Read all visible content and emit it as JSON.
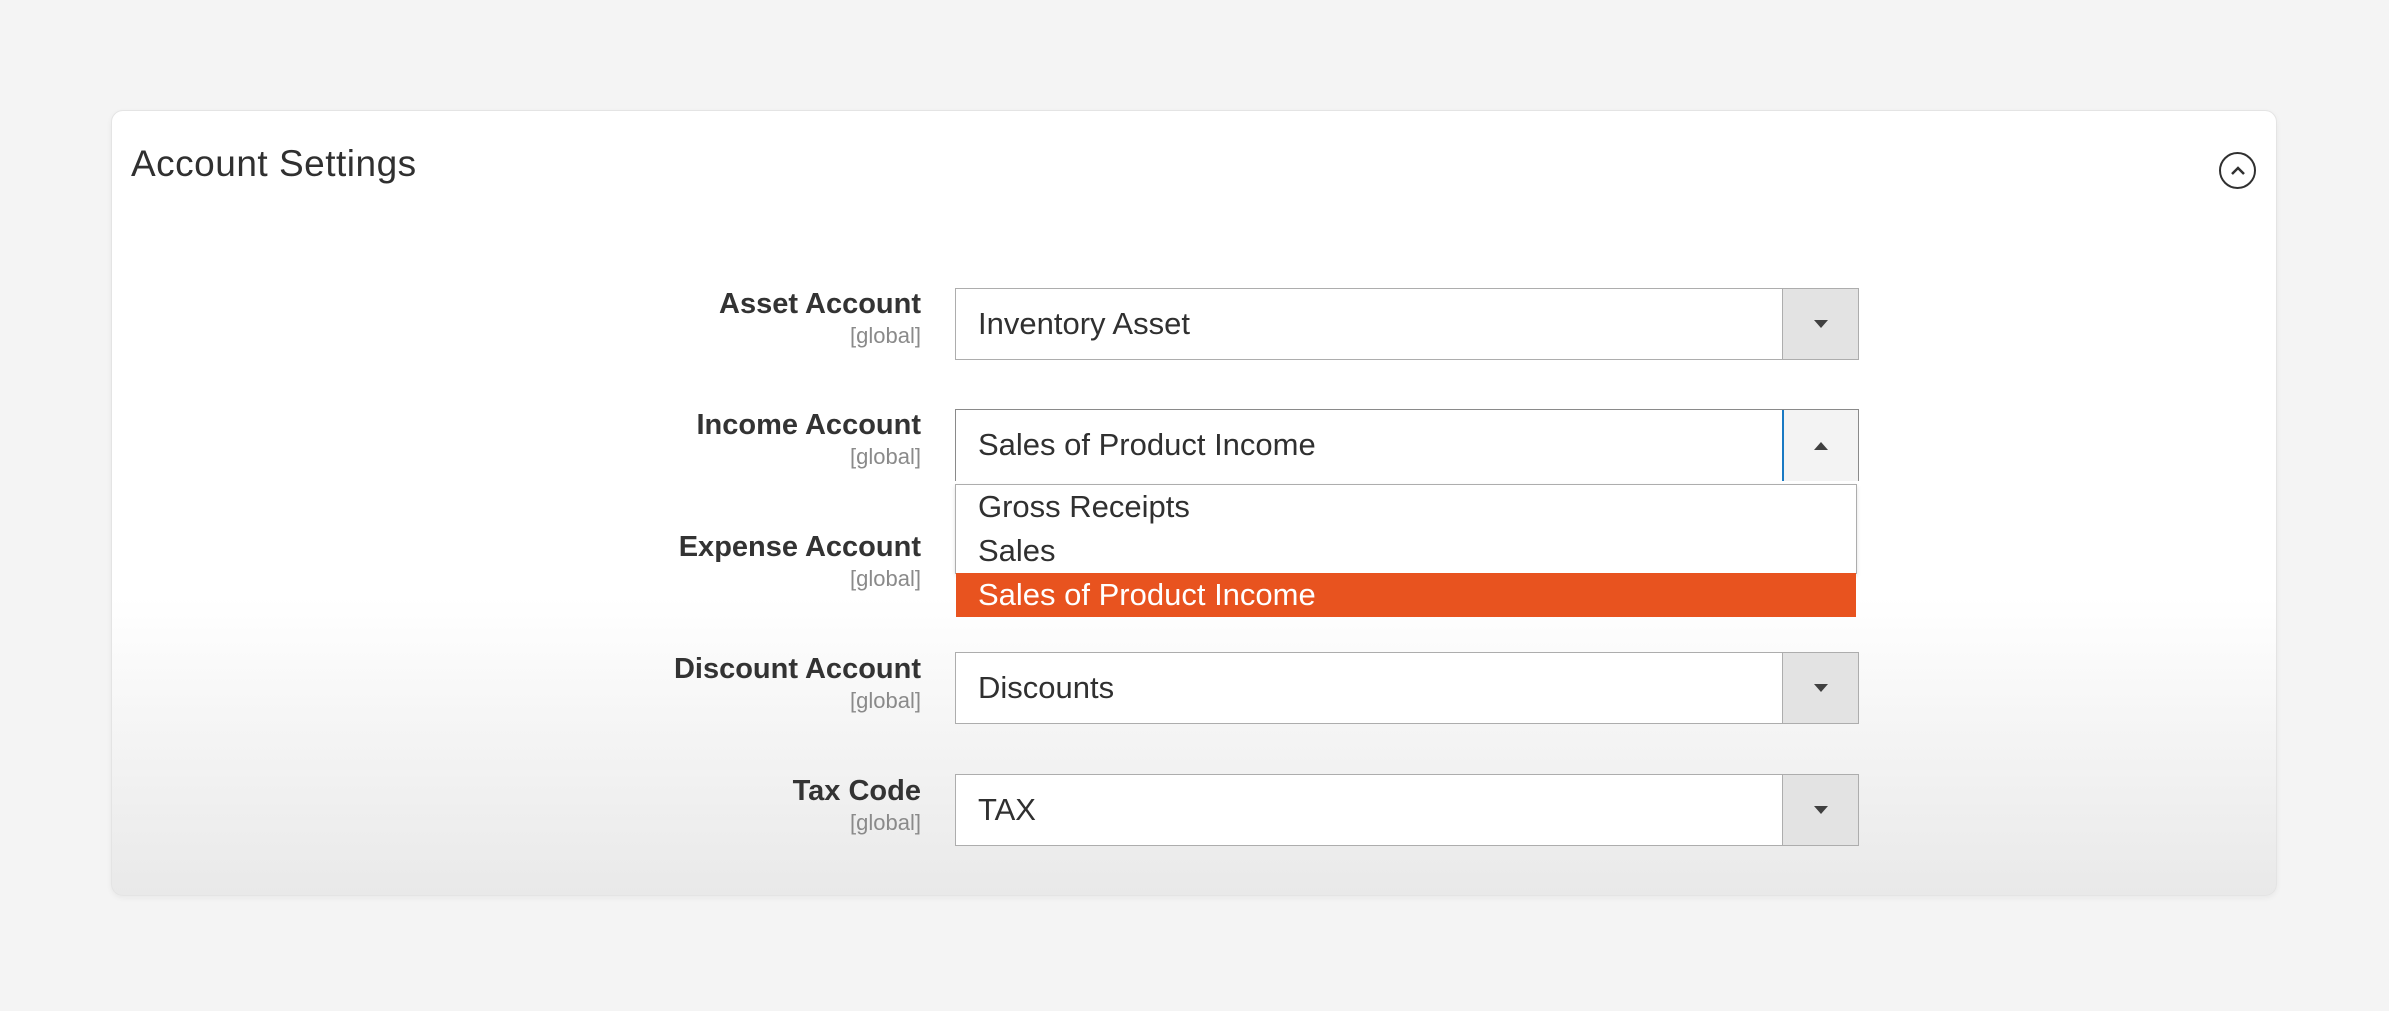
{
  "section": {
    "title": "Account Settings",
    "collapse_icon": "chevron-up-circle-icon"
  },
  "fields": [
    {
      "label": "Asset Account",
      "scope": "[global]",
      "value": "Inventory Asset",
      "open": false
    },
    {
      "label": "Income Account",
      "scope": "[global]",
      "value": "Sales of Product Income",
      "open": true
    },
    {
      "label": "Expense Account",
      "scope": "[global]",
      "value": "",
      "open": false
    },
    {
      "label": "Discount Account",
      "scope": "[global]",
      "value": "Discounts",
      "open": false
    },
    {
      "label": "Tax Code",
      "scope": "[global]",
      "value": "TAX",
      "open": false
    }
  ],
  "income_dropdown": {
    "options": [
      "Gross Receipts",
      "Sales",
      "Sales of Product Income"
    ],
    "selected": "Sales of Product Income"
  },
  "colors": {
    "highlight": "#e8531f",
    "focus": "#1979c3"
  }
}
